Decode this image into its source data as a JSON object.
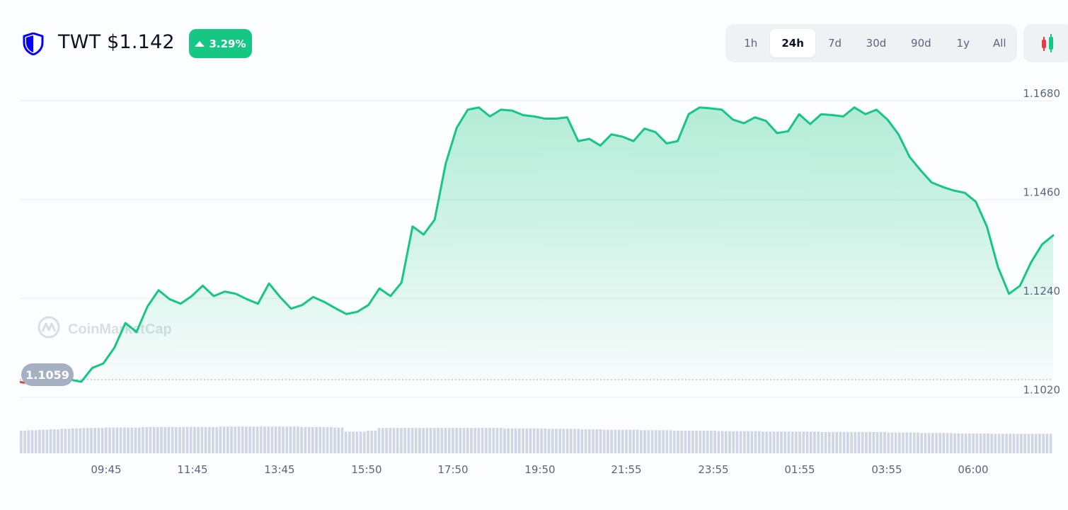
{
  "header": {
    "title": "TWT $1.142",
    "change": "3.29%",
    "ranges": [
      "1h",
      "24h",
      "7d",
      "30d",
      "90d",
      "1y",
      "All"
    ],
    "active_range": "24h"
  },
  "colors": {
    "up": "#16c784",
    "down": "#ea3943",
    "logo": "#0500ff",
    "grid": "#eff2f5",
    "volume": "#cfd6e4",
    "tooltip_bg": "#a6b0c3"
  },
  "icons": {
    "logo": "trust-wallet-shield-icon",
    "candle": "candlestick-icon",
    "watermark": "coinmarketcap-logo-icon"
  },
  "watermark": "CoinMarketCap",
  "chart_data": {
    "type": "area",
    "title": "",
    "xlabel": "",
    "ylabel": "",
    "ylim": [
      1.098,
      1.1715
    ],
    "y_ticks": [
      1.102,
      1.124,
      1.146,
      1.168
    ],
    "y_tick_labels": [
      "1.1020",
      "1.1240",
      "1.1460",
      "1.1680"
    ],
    "x_ticks": [
      "09:45",
      "11:45",
      "13:45",
      "15:50",
      "17:50",
      "19:50",
      "21:55",
      "23:55",
      "01:55",
      "03:55",
      "06:00"
    ],
    "open_price": 1.1059,
    "open_price_label": "1.1059",
    "x": [
      "08:20",
      "08:35",
      "08:50",
      "09:05",
      "09:15",
      "09:30",
      "09:45",
      "10:00",
      "10:15",
      "10:30",
      "10:45",
      "11:00",
      "11:15",
      "11:30",
      "11:45",
      "12:00",
      "12:15",
      "12:30",
      "12:45",
      "13:00",
      "13:15",
      "13:30",
      "13:45",
      "14:00",
      "14:15",
      "14:30",
      "14:45",
      "15:00",
      "15:15",
      "15:30",
      "15:50",
      "16:05",
      "16:20",
      "16:35",
      "16:50",
      "17:05",
      "17:20",
      "17:35",
      "17:50",
      "18:05",
      "18:20",
      "18:35",
      "18:50",
      "19:05",
      "19:20",
      "19:35",
      "19:50",
      "20:05",
      "20:20",
      "20:35",
      "20:50",
      "21:05",
      "21:20",
      "21:35",
      "21:55",
      "22:10",
      "22:25",
      "22:40",
      "22:55",
      "23:10",
      "23:25",
      "23:40",
      "23:55",
      "00:10",
      "00:25",
      "00:40",
      "00:55",
      "01:10",
      "01:25",
      "01:40",
      "01:55",
      "02:10",
      "02:25",
      "02:40",
      "02:55",
      "03:10",
      "03:25",
      "03:40",
      "03:55",
      "04:10",
      "04:25",
      "04:40",
      "04:55",
      "05:10",
      "05:25",
      "05:40",
      "06:00",
      "06:15",
      "06:30",
      "06:45",
      "07:00",
      "07:10"
    ],
    "series": [
      {
        "values": [
          1.1058,
          1.1054,
          1.1059,
          1.1054,
          1.1085,
          1.1095,
          1.113,
          1.1185,
          1.1165,
          1.1222,
          1.1258,
          1.1238,
          1.1228,
          1.1245,
          1.1268,
          1.1245,
          1.1255,
          1.125,
          1.1238,
          1.1228,
          1.1273,
          1.1243,
          1.1217,
          1.1225,
          1.1243,
          1.1232,
          1.1218,
          1.1205,
          1.121,
          1.1225,
          1.1262,
          1.1245,
          1.1275,
          1.14,
          1.1382,
          1.1415,
          1.154,
          1.162,
          1.166,
          1.1665,
          1.1645,
          1.166,
          1.1658,
          1.1648,
          1.1645,
          1.164,
          1.164,
          1.1643,
          1.159,
          1.1595,
          1.158,
          1.1605,
          1.16,
          1.159,
          1.1618,
          1.161,
          1.1585,
          1.159,
          1.165,
          1.1665,
          1.1663,
          1.166,
          1.1638,
          1.163,
          1.1643,
          1.1635,
          1.1608,
          1.1612,
          1.165,
          1.1628,
          1.165,
          1.1648,
          1.1645,
          1.1665,
          1.165,
          1.166,
          1.1638,
          1.1605,
          1.1555,
          1.1525,
          1.1498,
          1.1488,
          1.148,
          1.1475,
          1.1455,
          1.14,
          1.131,
          1.125,
          1.1268,
          1.132,
          1.136,
          1.138
        ]
      }
    ],
    "volume": [
      0.5,
      0.51,
      0.52,
      0.53,
      0.54,
      0.55,
      0.56,
      0.56,
      0.57,
      0.57,
      0.57,
      0.58,
      0.58,
      0.58,
      0.58,
      0.58,
      0.58,
      0.58,
      0.59,
      0.59,
      0.59,
      0.59,
      0.59,
      0.59,
      0.59,
      0.58,
      0.58,
      0.58,
      0.57,
      0.48,
      0.48,
      0.5,
      0.56,
      0.56,
      0.56,
      0.56,
      0.56,
      0.56,
      0.56,
      0.56,
      0.56,
      0.56,
      0.56,
      0.55,
      0.55,
      0.55,
      0.55,
      0.54,
      0.54,
      0.54,
      0.53,
      0.53,
      0.52,
      0.52,
      0.52,
      0.51,
      0.51,
      0.51,
      0.5,
      0.5,
      0.5,
      0.5,
      0.49,
      0.49,
      0.49,
      0.49,
      0.48,
      0.48,
      0.48,
      0.48,
      0.48,
      0.47,
      0.47,
      0.47,
      0.47,
      0.47,
      0.47,
      0.46,
      0.46,
      0.46,
      0.45,
      0.45,
      0.45,
      0.44,
      0.44,
      0.44,
      0.43,
      0.43,
      0.43,
      0.43,
      0.43,
      0.43
    ]
  }
}
